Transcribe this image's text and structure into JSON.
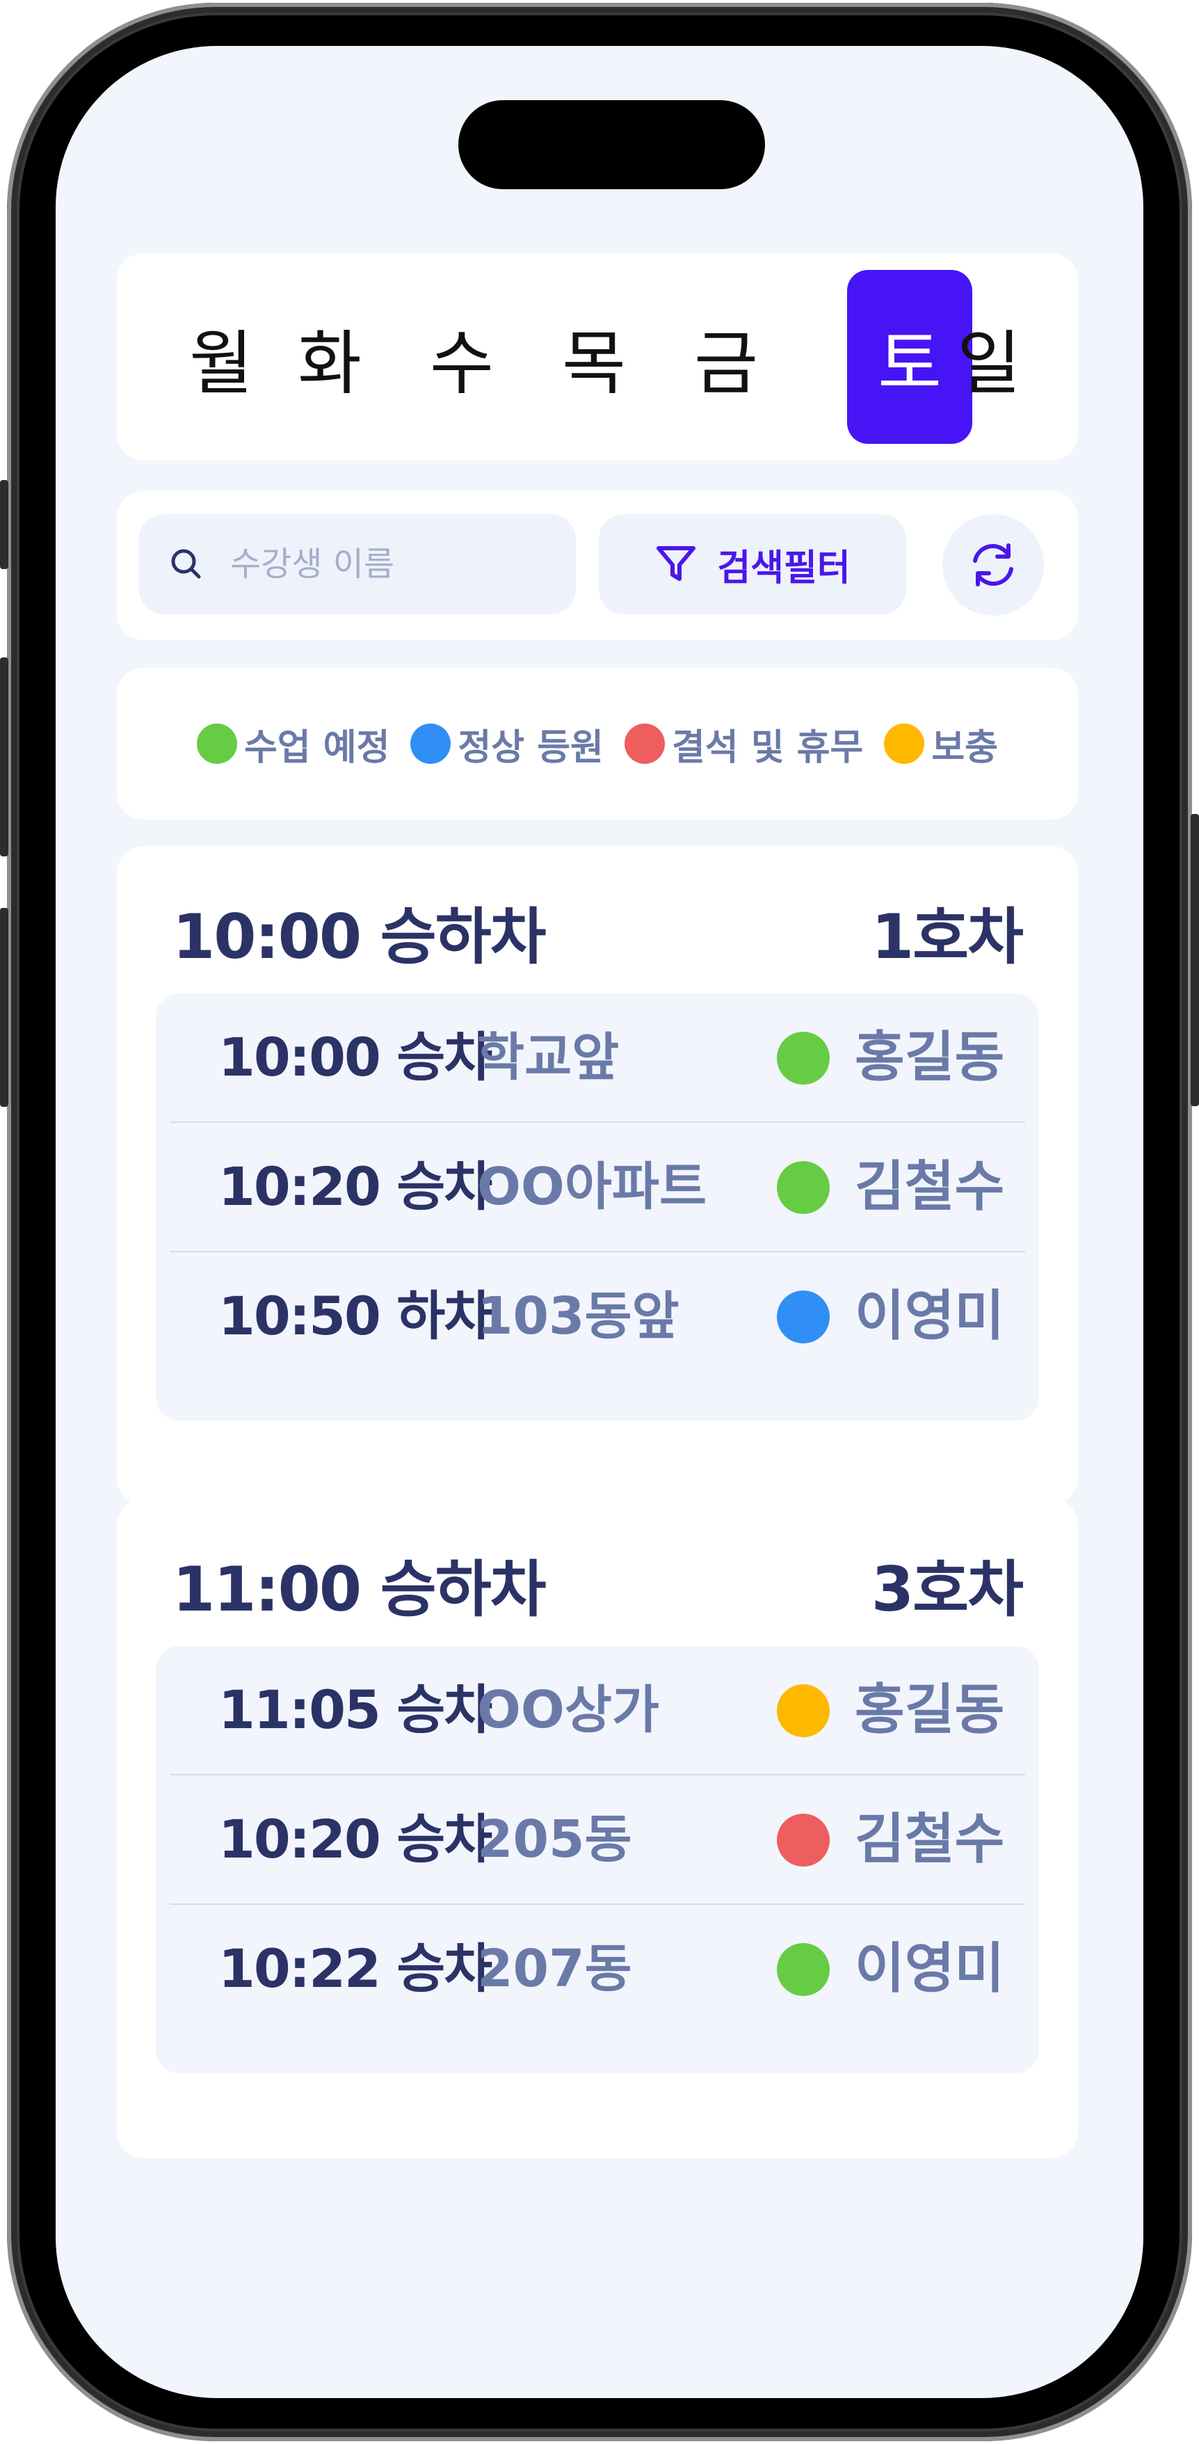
{
  "colors": {
    "accent": "#4714f5",
    "status_scheduled": "#66cc44",
    "status_attended": "#2f8ff7",
    "status_absent": "#ee5e5e",
    "status_makeup": "#ffb800"
  },
  "days": [
    {
      "label": "월",
      "active": false
    },
    {
      "label": "화",
      "active": false
    },
    {
      "label": "수",
      "active": false
    },
    {
      "label": "목",
      "active": false
    },
    {
      "label": "금",
      "active": false
    },
    {
      "label": "토",
      "active": true
    },
    {
      "label": "일",
      "active": false
    }
  ],
  "search": {
    "placeholder": "수강생 이름",
    "filter_label": "검색필터",
    "search_icon": "search-icon",
    "filter_icon": "filter-icon",
    "refresh_icon": "refresh-icon"
  },
  "legend": [
    {
      "label": "수업 예정",
      "color": "#66cc44"
    },
    {
      "label": "정상 등원",
      "color": "#2f8ff7"
    },
    {
      "label": "결석 및 휴무",
      "color": "#ee5e5e"
    },
    {
      "label": "보충",
      "color": "#ffb800"
    }
  ],
  "schedules": [
    {
      "title": "10:00 승하차",
      "vehicle": "1호차",
      "rows": [
        {
          "time": "10:00 승차",
          "place": "학교앞",
          "status_color": "#66cc44",
          "name": "홍길동"
        },
        {
          "time": "10:20 승차",
          "place": "OO아파트",
          "status_color": "#66cc44",
          "name": "김철수"
        },
        {
          "time": "10:50 하차",
          "place": "103동앞",
          "status_color": "#2f8ff7",
          "name": "이영미"
        }
      ]
    },
    {
      "title": "11:00 승하차",
      "vehicle": "3호차",
      "rows": [
        {
          "time": "11:05 승차",
          "place": "OO상가",
          "status_color": "#ffb800",
          "name": "홍길동"
        },
        {
          "time": "10:20 승차",
          "place": "205동",
          "status_color": "#ee5e5e",
          "name": "김철수"
        },
        {
          "time": "10:22 승차",
          "place": "207동",
          "status_color": "#66cc44",
          "name": "이영미"
        }
      ]
    }
  ]
}
